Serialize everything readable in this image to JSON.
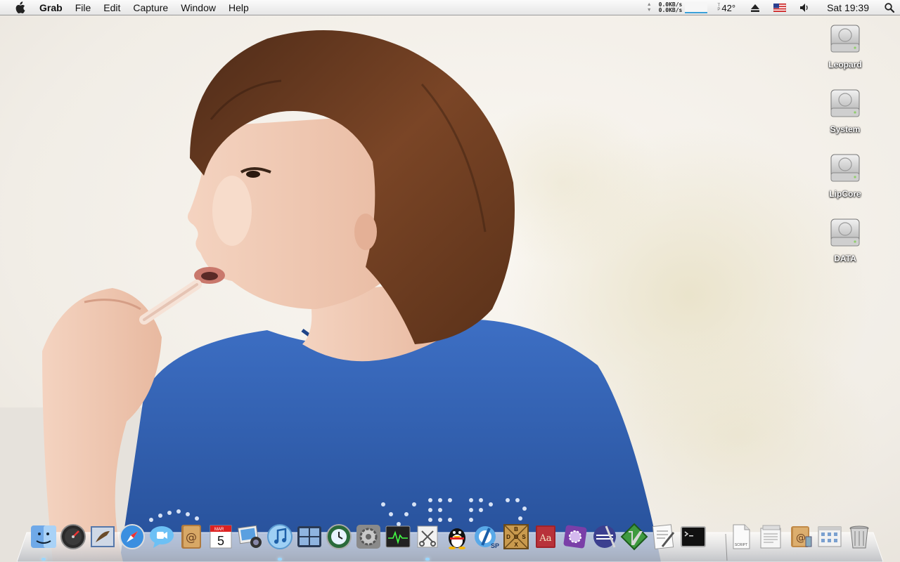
{
  "menubar": {
    "app_name": "Grab",
    "items": [
      "File",
      "Edit",
      "Capture",
      "Window",
      "Help"
    ],
    "network": {
      "up_rate": "0.0KB/s",
      "down_rate": "0.0KB/s"
    },
    "temperature": {
      "label_top": "T",
      "label_bottom": "P",
      "value": "42°"
    },
    "clock": "Sat 19:39"
  },
  "desktop": {
    "drives": [
      "Leopard",
      "System",
      "LipCore",
      "DATA"
    ]
  },
  "dock": {
    "apps": [
      "Finder",
      "Dashboard",
      "Mail",
      "Safari",
      "iChat",
      "Address Book",
      "iCal",
      "iPhoto",
      "iTunes",
      "Spaces",
      "Time Machine",
      "System Preferences",
      "Activity Monitor",
      "Grab",
      "QQ",
      "Thunder",
      "DOSBox",
      "Dictionary",
      "Mail Plugin",
      "Eclipse",
      "Vim",
      "Script Editor",
      "Terminal"
    ],
    "calendar_date": "5",
    "calendar_month": "MAR",
    "dosbox_letters": [
      "B",
      "D",
      "O",
      "S",
      "X"
    ],
    "docs": [
      "Script",
      "Documents",
      "Address",
      "Applications",
      "Trash"
    ]
  },
  "colors": {
    "menubar_top": "#fbfbfb",
    "accent_blue": "#3aa0d8",
    "shirt_blue": "#2f5fb0",
    "hair": "#6a3a20"
  }
}
